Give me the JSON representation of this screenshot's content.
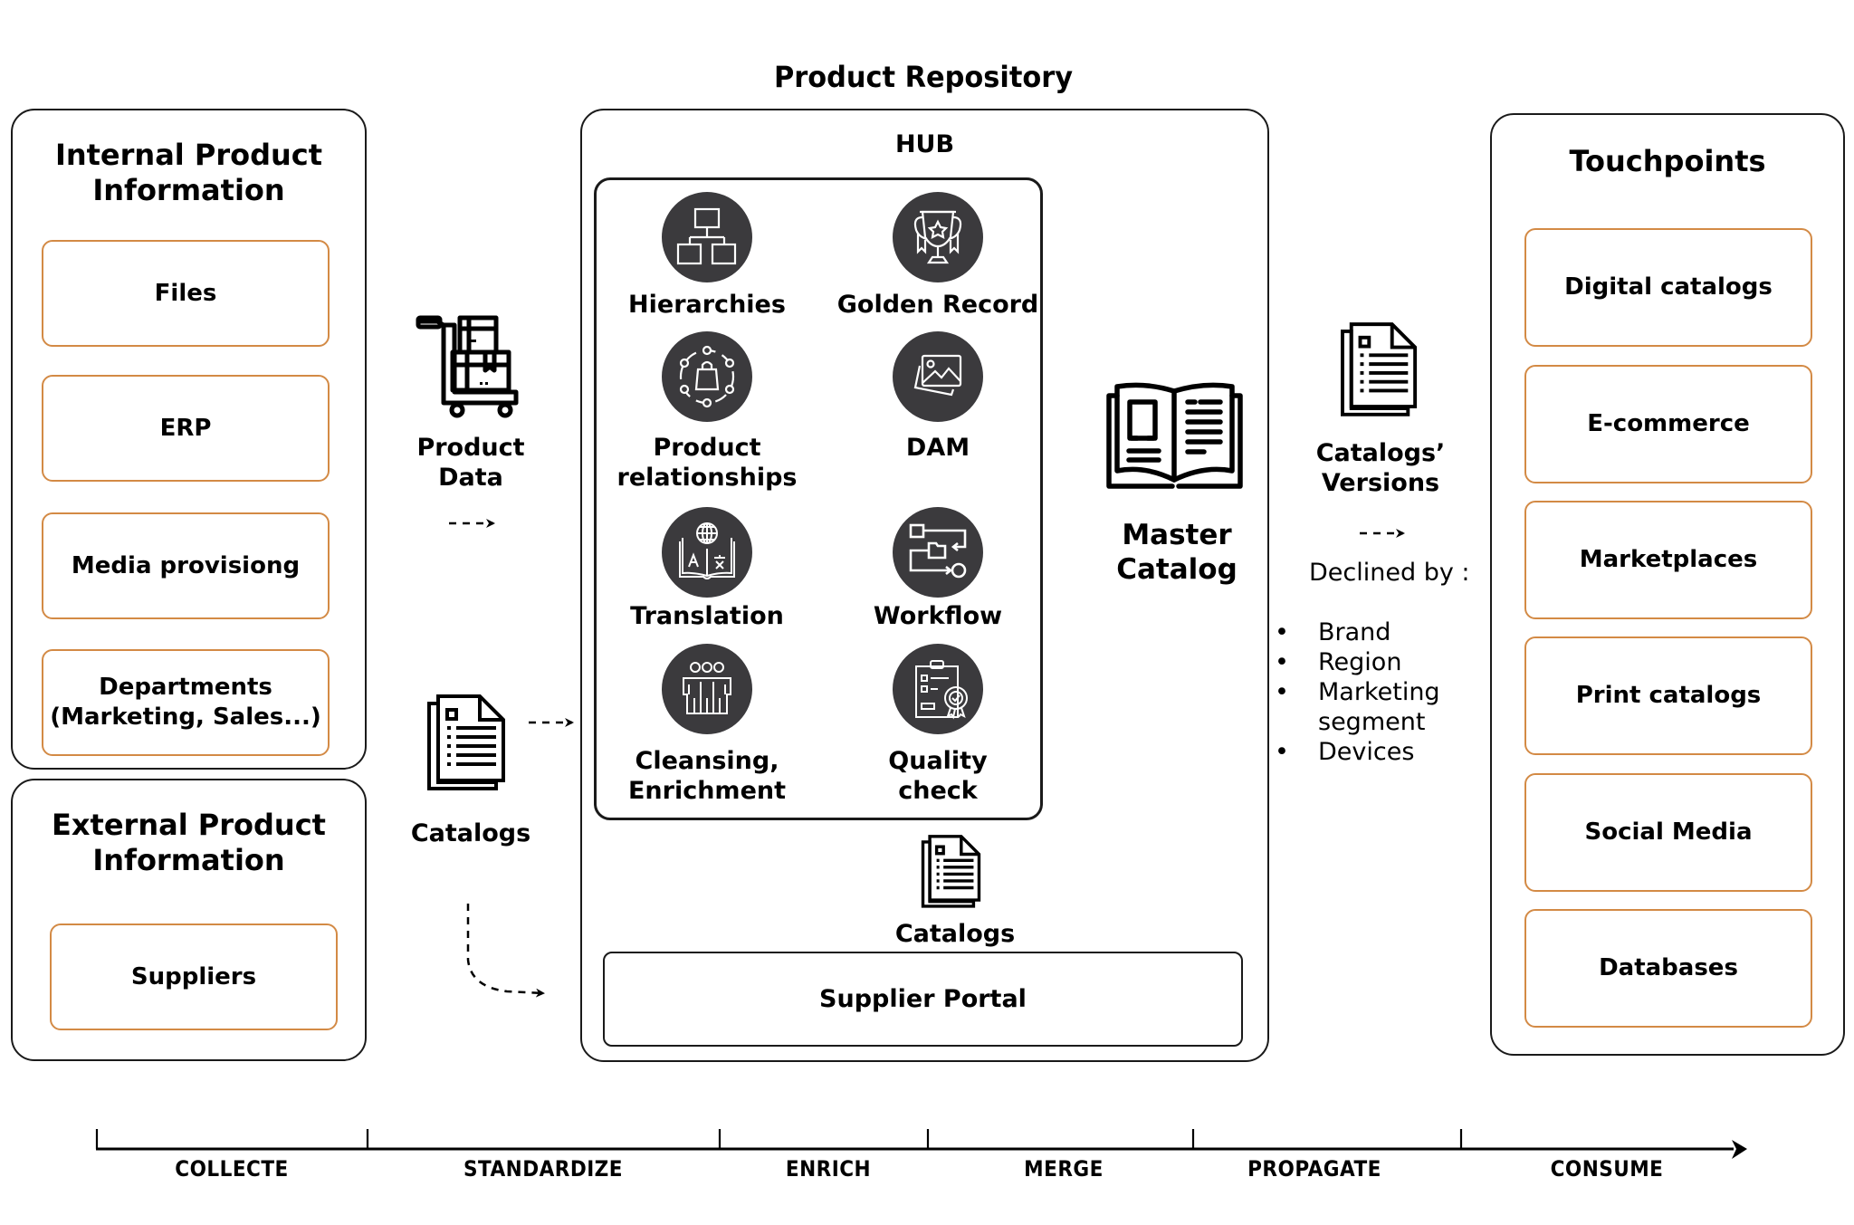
{
  "title": "Product Repository",
  "internal": {
    "title_line1": "Internal Product",
    "title_line2": "Information",
    "items": [
      "Files",
      "ERP",
      "Media provisiong"
    ],
    "departments_line1": "Departments",
    "departments_line2": "(Marketing, Sales...)"
  },
  "external": {
    "title_line1": "External Product",
    "title_line2": "Information",
    "items": [
      "Suppliers"
    ]
  },
  "flow": {
    "product_data_line1": "Product",
    "product_data_line2": "Data",
    "catalogs_left": "Catalogs",
    "catalogs_supplier": "Catalogs"
  },
  "hub": {
    "label": "HUB",
    "features": [
      {
        "line1": "Hierarchies",
        "line2": "",
        "icon": "hierarchy-icon"
      },
      {
        "line1": "Golden Record",
        "line2": "",
        "icon": "trophy-icon"
      },
      {
        "line1": "Product",
        "line2": "relationships",
        "icon": "product-network-icon"
      },
      {
        "line1": "DAM",
        "line2": "",
        "icon": "image-gallery-icon"
      },
      {
        "line1": "Translation",
        "line2": "",
        "icon": "translation-book-icon"
      },
      {
        "line1": "Workflow",
        "line2": "",
        "icon": "workflow-icon"
      },
      {
        "line1": "Cleansing,",
        "line2": "Enrichment",
        "icon": "team-icon"
      },
      {
        "line1": "Quality",
        "line2": "check",
        "icon": "quality-clipboard-icon"
      }
    ],
    "master_line1": "Master",
    "master_line2": "Catalog",
    "supplier_portal": "Supplier Portal"
  },
  "propagate": {
    "versions_line1": "Catalogs’",
    "versions_line2": "Versions",
    "declined_by": "Declined by :",
    "bullets": [
      "Brand",
      "Region",
      "Marketing",
      "Devices"
    ],
    "bullet_continuation": "segment"
  },
  "touchpoints": {
    "title": "Touchpoints",
    "items": [
      "Digital catalogs",
      "E-commerce",
      "Marketplaces",
      "Print catalogs",
      "Social Media",
      "Databases"
    ]
  },
  "timeline": {
    "stages": [
      "COLLECTE",
      "STANDARDIZE",
      "ENRICH",
      "MERGE",
      "PROPAGATE",
      "CONSUME"
    ]
  },
  "colors": {
    "accent_border": "#d38a45",
    "icon_circle": "#3b3a3d",
    "outline": "#1a1a1a"
  }
}
